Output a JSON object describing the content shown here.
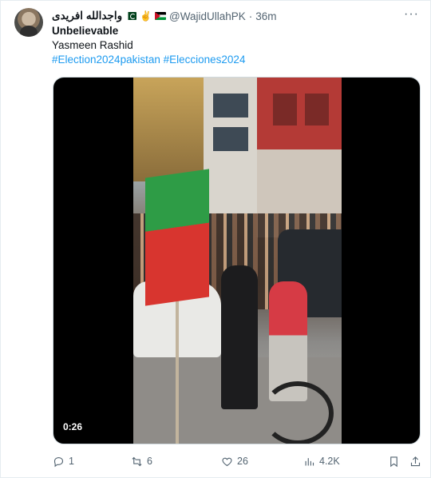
{
  "tweet": {
    "display_name": "واجدالله افریدی",
    "emoji_victory": "✌",
    "handle": "@WajidUllahPK",
    "separator": "·",
    "time": "36m",
    "more": "···",
    "lines": {
      "line1": "Unbelievable",
      "line2": "Yasmeen Rashid",
      "hashtag1": "#Election2024pakistan",
      "hashtag2": "#Elecciones2024"
    },
    "video": {
      "duration": "0:26"
    },
    "stats": {
      "replies": "1",
      "reposts": "6",
      "likes": "26",
      "views": "4.2K"
    }
  },
  "colors": {
    "accent": "#1d9bf0",
    "muted": "#536471",
    "text": "#0f1419"
  },
  "icons": [
    "avatar",
    "pakistan-flag-icon",
    "victory-hand-icon",
    "palestine-flag-icon",
    "more-icon",
    "reply-icon",
    "repost-icon",
    "like-icon",
    "views-icon",
    "bookmark-icon",
    "share-icon"
  ]
}
